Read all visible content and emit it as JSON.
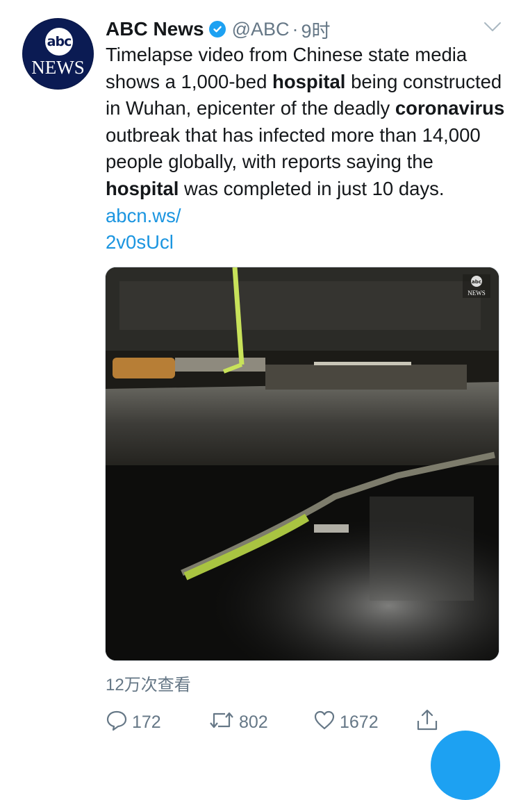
{
  "tweet": {
    "avatar": {
      "logo_top": "abc",
      "logo_bottom": "NEWS",
      "bg_color": "#0b1b53"
    },
    "author": {
      "display_name": "ABC News",
      "verified": true,
      "handle": "@ABC",
      "separator": "·",
      "time": "9时"
    },
    "menu_icon": "chevron-down-icon",
    "text": {
      "segments": [
        {
          "text": "Timelapse video from Chinese state media shows a 1,000-bed "
        },
        {
          "text": "hospital",
          "bold": true
        },
        {
          "text": " being constructed in Wuhan, epicenter of the deadly "
        },
        {
          "text": "coronavirus",
          "bold": true
        },
        {
          "text": " outbreak that has infected more than 14,000 people globally, with reports saying the "
        },
        {
          "text": "hospital",
          "bold": true
        },
        {
          "text": " was completed in just 10 days. "
        },
        {
          "text": "abcn.ws/\n2v0sUcl",
          "link": true
        }
      ]
    },
    "media": {
      "watermark_top": "abc",
      "watermark_bottom": "NEWS"
    },
    "views": "12万次查看",
    "actions": {
      "reply": {
        "icon": "reply-icon",
        "count": "172"
      },
      "retweet": {
        "icon": "retweet-icon",
        "count": "802"
      },
      "like": {
        "icon": "heart-icon",
        "count": "1672"
      },
      "share": {
        "icon": "share-icon"
      }
    },
    "colors": {
      "accent": "#1da1f2",
      "link": "#1b95e0",
      "secondary_text": "#657786",
      "primary_text": "#14171a"
    }
  }
}
